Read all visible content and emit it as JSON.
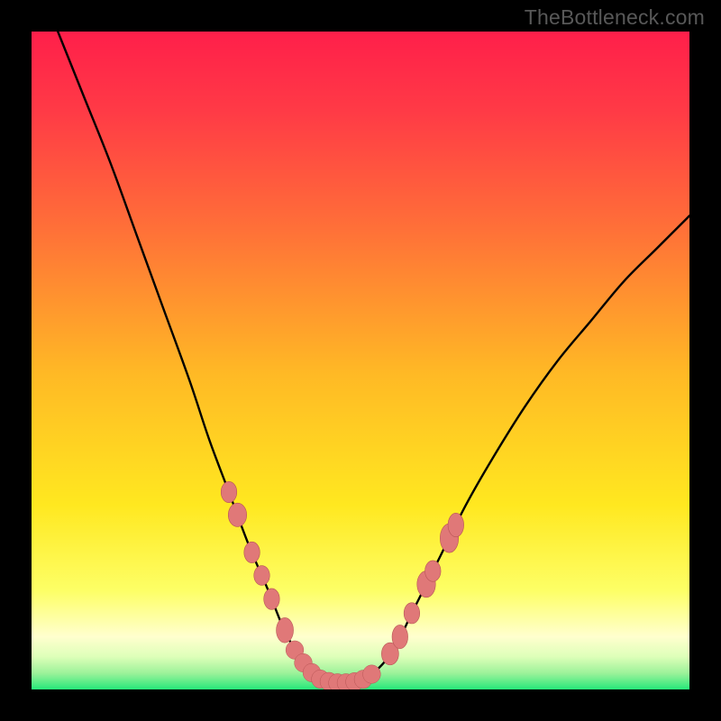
{
  "watermark": "TheBottleneck.com",
  "colors": {
    "black": "#000000",
    "top": "#ff1f4a",
    "mid_red": "#ff4848",
    "orange": "#ffa030",
    "yellow": "#ffe820",
    "pale_yellow": "#ffffa0",
    "pale_green": "#d8ffb0",
    "green": "#26e87a",
    "curve": "#000000",
    "marker_fill": "#e07878",
    "marker_stroke": "#b85555"
  },
  "chart_data": {
    "type": "line",
    "title": "",
    "xlabel": "",
    "ylabel": "",
    "xlim": [
      0,
      100
    ],
    "ylim": [
      0,
      100
    ],
    "note": "V-shaped bottleneck curve. x is normalized component scale (0-100); y is bottleneck severity percentage (0 at minimum, ~100 at extremes). Values estimated from pixel positions; no axis ticks or numeric labels are rendered in the image.",
    "series": [
      {
        "name": "bottleneck-curve",
        "x": [
          0,
          4,
          8,
          12,
          16,
          20,
          24,
          27,
          30,
          33,
          36,
          38,
          40,
          42,
          44,
          46,
          48,
          50,
          52,
          55,
          58,
          62,
          66,
          70,
          75,
          80,
          85,
          90,
          95,
          100
        ],
        "y": [
          110,
          100,
          90,
          80,
          69,
          58,
          47,
          38,
          30,
          22,
          15,
          10,
          6,
          3,
          1.5,
          1,
          1,
          1.3,
          2.5,
          6,
          12,
          20,
          28,
          35,
          43,
          50,
          56,
          62,
          67,
          72
        ]
      }
    ],
    "markers": {
      "name": "highlighted-points",
      "note": "Salmon elliptical markers clustered near the valley on both limbs and along the flat bottom.",
      "points": [
        {
          "x": 30.0,
          "y": 30.0,
          "rx": 1.2,
          "ry": 1.6
        },
        {
          "x": 31.3,
          "y": 27.0,
          "rx": 1.4,
          "ry": 1.8
        },
        {
          "x": 33.5,
          "y": 21.0,
          "rx": 1.2,
          "ry": 1.6
        },
        {
          "x": 35.0,
          "y": 17.5,
          "rx": 1.2,
          "ry": 1.5
        },
        {
          "x": 36.5,
          "y": 13.5,
          "rx": 1.2,
          "ry": 1.6
        },
        {
          "x": 38.5,
          "y": 9.0,
          "rx": 1.3,
          "ry": 1.9
        },
        {
          "x": 54.5,
          "y": 5.0,
          "rx": 1.3,
          "ry": 1.7
        },
        {
          "x": 56.0,
          "y": 8.5,
          "rx": 1.2,
          "ry": 1.8
        },
        {
          "x": 57.8,
          "y": 12.5,
          "rx": 1.2,
          "ry": 1.6
        },
        {
          "x": 60.0,
          "y": 17.0,
          "rx": 1.4,
          "ry": 2.0
        },
        {
          "x": 61.0,
          "y": 19.5,
          "rx": 1.2,
          "ry": 1.6
        },
        {
          "x": 63.5,
          "y": 24.5,
          "rx": 1.4,
          "ry": 2.2
        },
        {
          "x": 64.5,
          "y": 27.0,
          "rx": 1.2,
          "ry": 1.8
        }
      ],
      "bottom_band": {
        "x0": 40.0,
        "x1": 52.5,
        "y": 1.2,
        "ry": 1.4
      }
    }
  }
}
